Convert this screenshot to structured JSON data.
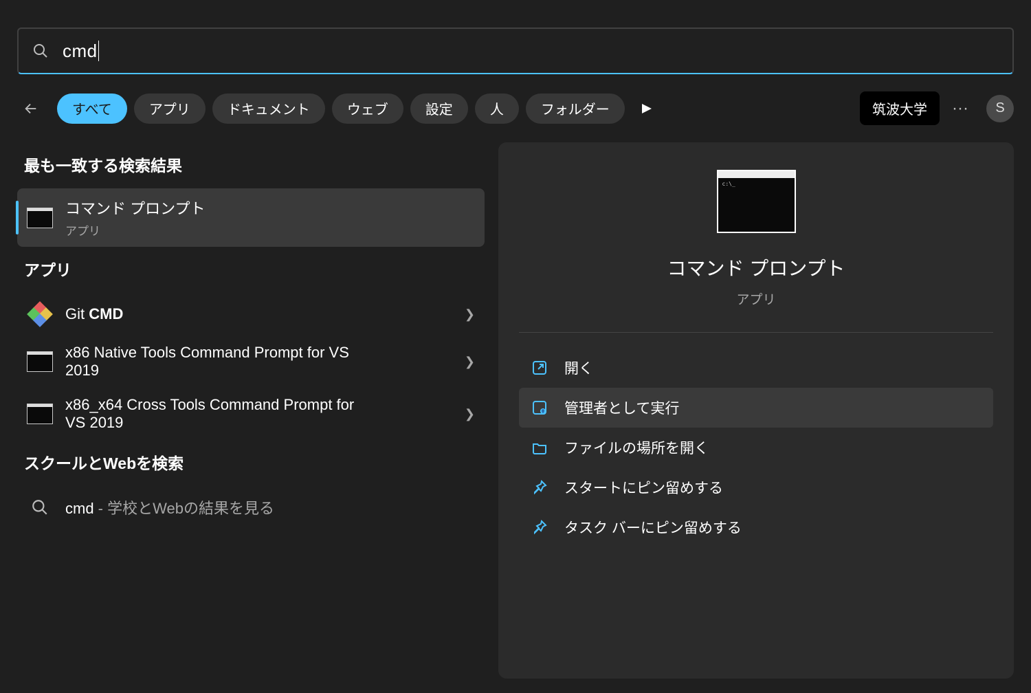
{
  "search": {
    "query": "cmd"
  },
  "tabs": {
    "items": [
      "すべて",
      "アプリ",
      "ドキュメント",
      "ウェブ",
      "設定",
      "人",
      "フォルダー"
    ],
    "chip": "筑波大学",
    "avatar_initial": "S"
  },
  "left": {
    "section_best": "最も一致する検索結果",
    "best": {
      "title": "コマンド プロンプト",
      "category": "アプリ"
    },
    "section_apps": "アプリ",
    "apps": [
      {
        "title_pre": "Git ",
        "title_bold": "CMD",
        "title_post": ""
      },
      {
        "title": "x86 Native Tools Command Prompt for VS 2019"
      },
      {
        "title": "x86_x64 Cross Tools Command Prompt for VS 2019"
      }
    ],
    "section_web": "スクールとWebを検索",
    "web": {
      "query": "cmd",
      "suffix": " - 学校とWebの結果を見る"
    }
  },
  "right": {
    "title": "コマンド プロンプト",
    "category": "アプリ",
    "actions": [
      "開く",
      "管理者として実行",
      "ファイルの場所を開く",
      "スタートにピン留めする",
      "タスク バーにピン留めする"
    ]
  }
}
